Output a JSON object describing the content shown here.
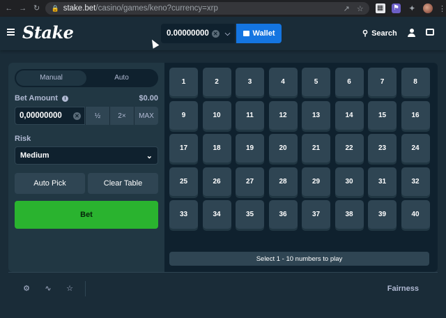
{
  "browser": {
    "url_host": "stake.bet",
    "url_path": "/casino/games/keno?currency=xrp"
  },
  "header": {
    "logo": "Stake",
    "balance": "0.00000000",
    "wallet_label": "Wallet",
    "search_label": "Search"
  },
  "sidebar": {
    "tabs": [
      {
        "label": "Manual",
        "active": true
      },
      {
        "label": "Auto",
        "active": false
      }
    ],
    "bet_amount_label": "Bet Amount",
    "bet_amount_usd": "$0.00",
    "bet_amount_value": "0,00000000",
    "half_label": "½",
    "double_label": "2×",
    "max_label": "MAX",
    "risk_label": "Risk",
    "risk_value": "Medium",
    "auto_pick_label": "Auto Pick",
    "clear_table_label": "Clear Table",
    "bet_label": "Bet"
  },
  "board": {
    "numbers": [
      "1",
      "2",
      "3",
      "4",
      "5",
      "6",
      "7",
      "8",
      "9",
      "10",
      "11",
      "12",
      "13",
      "14",
      "15",
      "16",
      "17",
      "18",
      "19",
      "20",
      "21",
      "22",
      "23",
      "24",
      "25",
      "26",
      "27",
      "28",
      "29",
      "30",
      "31",
      "32",
      "33",
      "34",
      "35",
      "36",
      "37",
      "38",
      "39",
      "40"
    ],
    "hint": "Select 1 - 10 numbers to play"
  },
  "footer": {
    "fairness_label": "Fairness"
  },
  "colors": {
    "bg": "#1a2c38",
    "panel": "#213743",
    "tile": "#2f4553",
    "bet_green": "#2ab32f",
    "wallet_blue": "#1475e1"
  }
}
